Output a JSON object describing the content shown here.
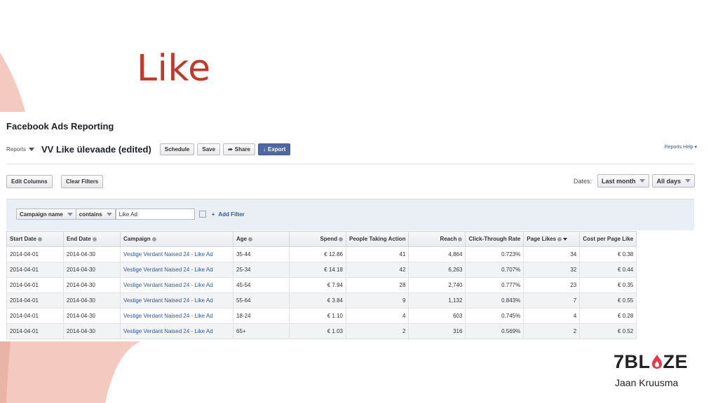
{
  "slide": {
    "title": "Like"
  },
  "colors": {
    "accent": "#c0392b",
    "link": "#365899",
    "export_button": "#4e69a2",
    "deco": "#f4c9bf"
  },
  "header": {
    "app_title": "Facebook Ads Reporting",
    "reports_label": "Reports",
    "report_name": "VV Like ülevaade (edited)",
    "buttons": {
      "schedule": "Schedule",
      "save": "Save",
      "share": "Share",
      "export": "Export"
    },
    "help": "Reports Help ▾"
  },
  "toolbar": {
    "edit_columns": "Edit Columns",
    "clear_filters": "Clear Filters",
    "dates_label": "Dates:",
    "date_range": "Last month",
    "day_filter": "All days"
  },
  "filter": {
    "field": "Campaign name",
    "operator": "contains",
    "value": "Like Ad",
    "add_filter": "Add Filter"
  },
  "table": {
    "columns": [
      "Start Date",
      "End Date",
      "Campaign",
      "Age",
      "Spend",
      "People Taking Action",
      "Reach",
      "Click-Through Rate",
      "Page Likes",
      "Cost per Page Like"
    ],
    "rows": [
      [
        "2014-04-01",
        "2014-04-30",
        "Vestige Verdant Naised 24 - Like Ad",
        "35-44",
        "€ 12.86",
        "41",
        "4,864",
        "0.723%",
        "34",
        "€ 0.38"
      ],
      [
        "2014-04-01",
        "2014-04-30",
        "Vestige Verdant Naised 24 - Like Ad",
        "25-34",
        "€ 14.18",
        "42",
        "6,263",
        "0.707%",
        "32",
        "€ 0.44"
      ],
      [
        "2014-04-01",
        "2014-04-30",
        "Vestige Verdant Naised 24 - Like Ad",
        "45-54",
        "€ 7.94",
        "28",
        "2,740",
        "0.777%",
        "23",
        "€ 0.35"
      ],
      [
        "2014-04-01",
        "2014-04-30",
        "Vestige Verdant Naised 24 - Like Ad",
        "55-64",
        "€ 3.84",
        "9",
        "1,132",
        "0.843%",
        "7",
        "€ 0.55"
      ],
      [
        "2014-04-01",
        "2014-04-30",
        "Vestige Verdant Naised 24 - Like Ad",
        "18-24",
        "€ 1.10",
        "4",
        "603",
        "0.745%",
        "4",
        "€ 0.28"
      ],
      [
        "2014-04-01",
        "2014-04-30",
        "Vestige Verdant Naised 24 - Like Ad",
        "65+",
        "€ 1.03",
        "2",
        "316",
        "0.569%",
        "2",
        "€ 0.52"
      ]
    ]
  },
  "brand": {
    "logo_text_left": "7BL",
    "logo_text_right": "ZE",
    "person": "Jaan Kruusma"
  }
}
